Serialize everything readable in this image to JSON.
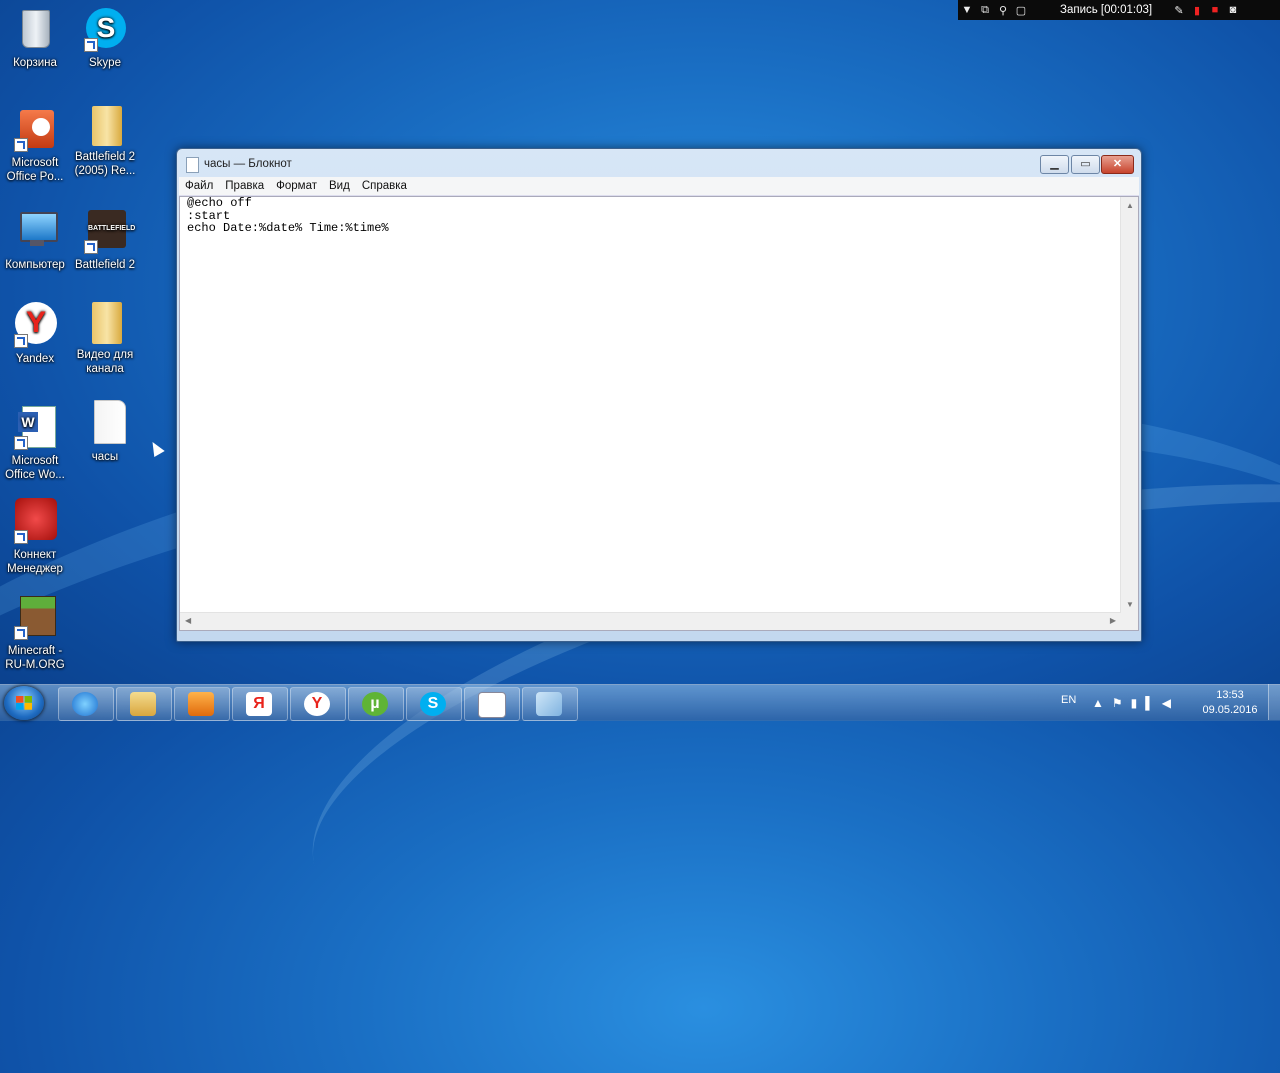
{
  "recorder": {
    "label": "Запись [00:01:03]",
    "icons": [
      "dropdown-icon",
      "window-icon",
      "zoom-icon",
      "region-icon",
      "pen-icon",
      "pause-icon",
      "stop-icon",
      "camera-icon"
    ]
  },
  "desktop_icons": [
    {
      "label": "Корзина",
      "icon": "recycle-bin-icon"
    },
    {
      "label": "Skype",
      "icon": "skype-icon"
    },
    {
      "label": "Microsoft Office Po...",
      "icon": "powerpoint-icon"
    },
    {
      "label": "Battlefield 2 (2005) Re...",
      "icon": "folder-icon"
    },
    {
      "label": "Компьютер",
      "icon": "computer-icon"
    },
    {
      "label": "Battlefield 2",
      "icon": "battlefield-icon"
    },
    {
      "label": "Yandex",
      "icon": "yandex-icon"
    },
    {
      "label": "Видео для канала",
      "icon": "folder-icon"
    },
    {
      "label": "Microsoft Office Wo...",
      "icon": "word-icon"
    },
    {
      "label": "часы",
      "icon": "text-file-icon"
    },
    {
      "label": "Коннект Менеджер",
      "icon": "connect-manager-icon"
    },
    {
      "label": "Minecraft - RU-M.ORG",
      "icon": "minecraft-icon"
    }
  ],
  "notepad": {
    "title": "часы — Блокнот",
    "menu": [
      "Файл",
      "Правка",
      "Формат",
      "Вид",
      "Справка"
    ],
    "content": "@echo off\n:start\necho Date:%date% Time:%time%"
  },
  "taskbar": {
    "apps": [
      "internet-explorer-icon",
      "explorer-icon",
      "media-player-icon",
      "yandex-browser-icon",
      "yandex-icon",
      "utorrent-icon",
      "skype-icon",
      "notepad-icon",
      "paint-icon"
    ],
    "language": "EN",
    "time": "13:53",
    "date": "09.05.2016"
  }
}
